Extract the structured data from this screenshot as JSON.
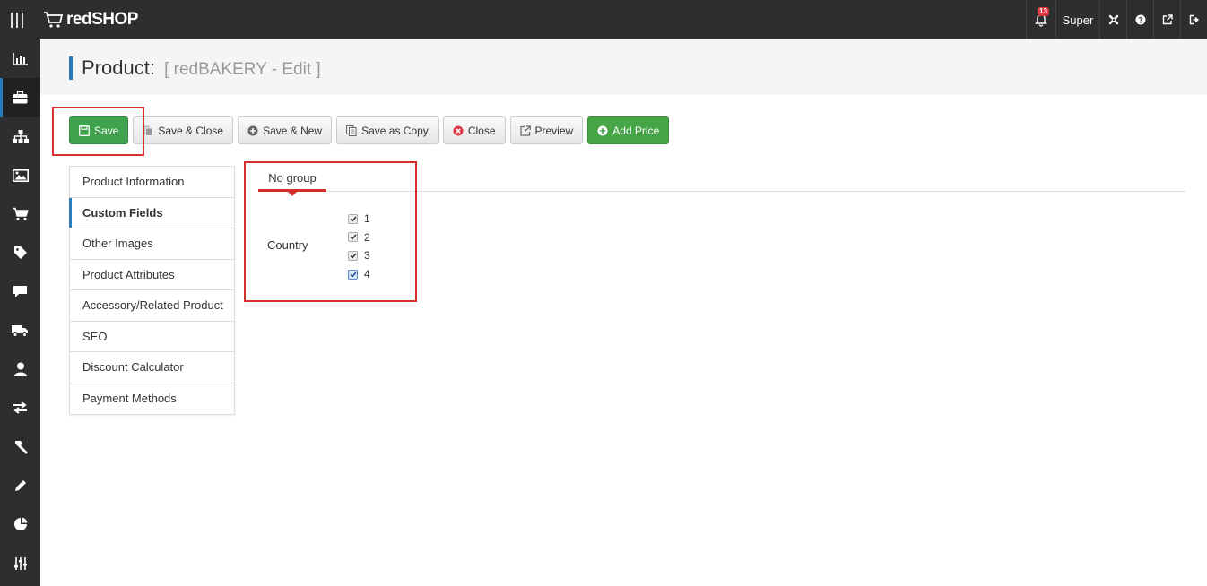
{
  "app": {
    "name": "redSHOP"
  },
  "topbar": {
    "notifications_count": "13",
    "user_label": "Super"
  },
  "sidebar": {
    "items": [
      {
        "icon": "bar-chart-icon"
      },
      {
        "icon": "briefcase-icon",
        "active": true
      },
      {
        "icon": "sitemap-icon"
      },
      {
        "icon": "image-icon"
      },
      {
        "icon": "cart-icon"
      },
      {
        "icon": "tag-icon"
      },
      {
        "icon": "comment-icon"
      },
      {
        "icon": "truck-icon"
      },
      {
        "icon": "user-icon"
      },
      {
        "icon": "exchange-icon"
      },
      {
        "icon": "hammer-icon"
      },
      {
        "icon": "pencil-icon"
      },
      {
        "icon": "pie-chart-icon"
      },
      {
        "icon": "sliders-icon"
      }
    ]
  },
  "header": {
    "title": "Product:",
    "subtitle": "[ redBAKERY - Edit ]"
  },
  "toolbar": {
    "save": "Save",
    "save_close": "Save & Close",
    "save_new": "Save & New",
    "save_copy": "Save as Copy",
    "close": "Close",
    "preview": "Preview",
    "add_price": "Add Price"
  },
  "tabs": {
    "items": [
      {
        "label": "Product Information"
      },
      {
        "label": "Custom Fields",
        "active": true
      },
      {
        "label": "Other Images"
      },
      {
        "label": "Product Attributes"
      },
      {
        "label": "Accessory/Related Product"
      },
      {
        "label": "SEO"
      },
      {
        "label": "Discount Calculator"
      },
      {
        "label": "Payment Methods"
      }
    ]
  },
  "custom_fields": {
    "group_tab": "No group",
    "field_label": "Country",
    "options": [
      {
        "label": "1",
        "checked": true
      },
      {
        "label": "2",
        "checked": true
      },
      {
        "label": "3",
        "checked": true
      },
      {
        "label": "4",
        "checked": true
      }
    ]
  },
  "colors": {
    "topbar": "#2c2e30",
    "accent_blue": "#2b7bb9",
    "save_green": "#3fa34d",
    "highlight_red": "#d32f2f"
  }
}
